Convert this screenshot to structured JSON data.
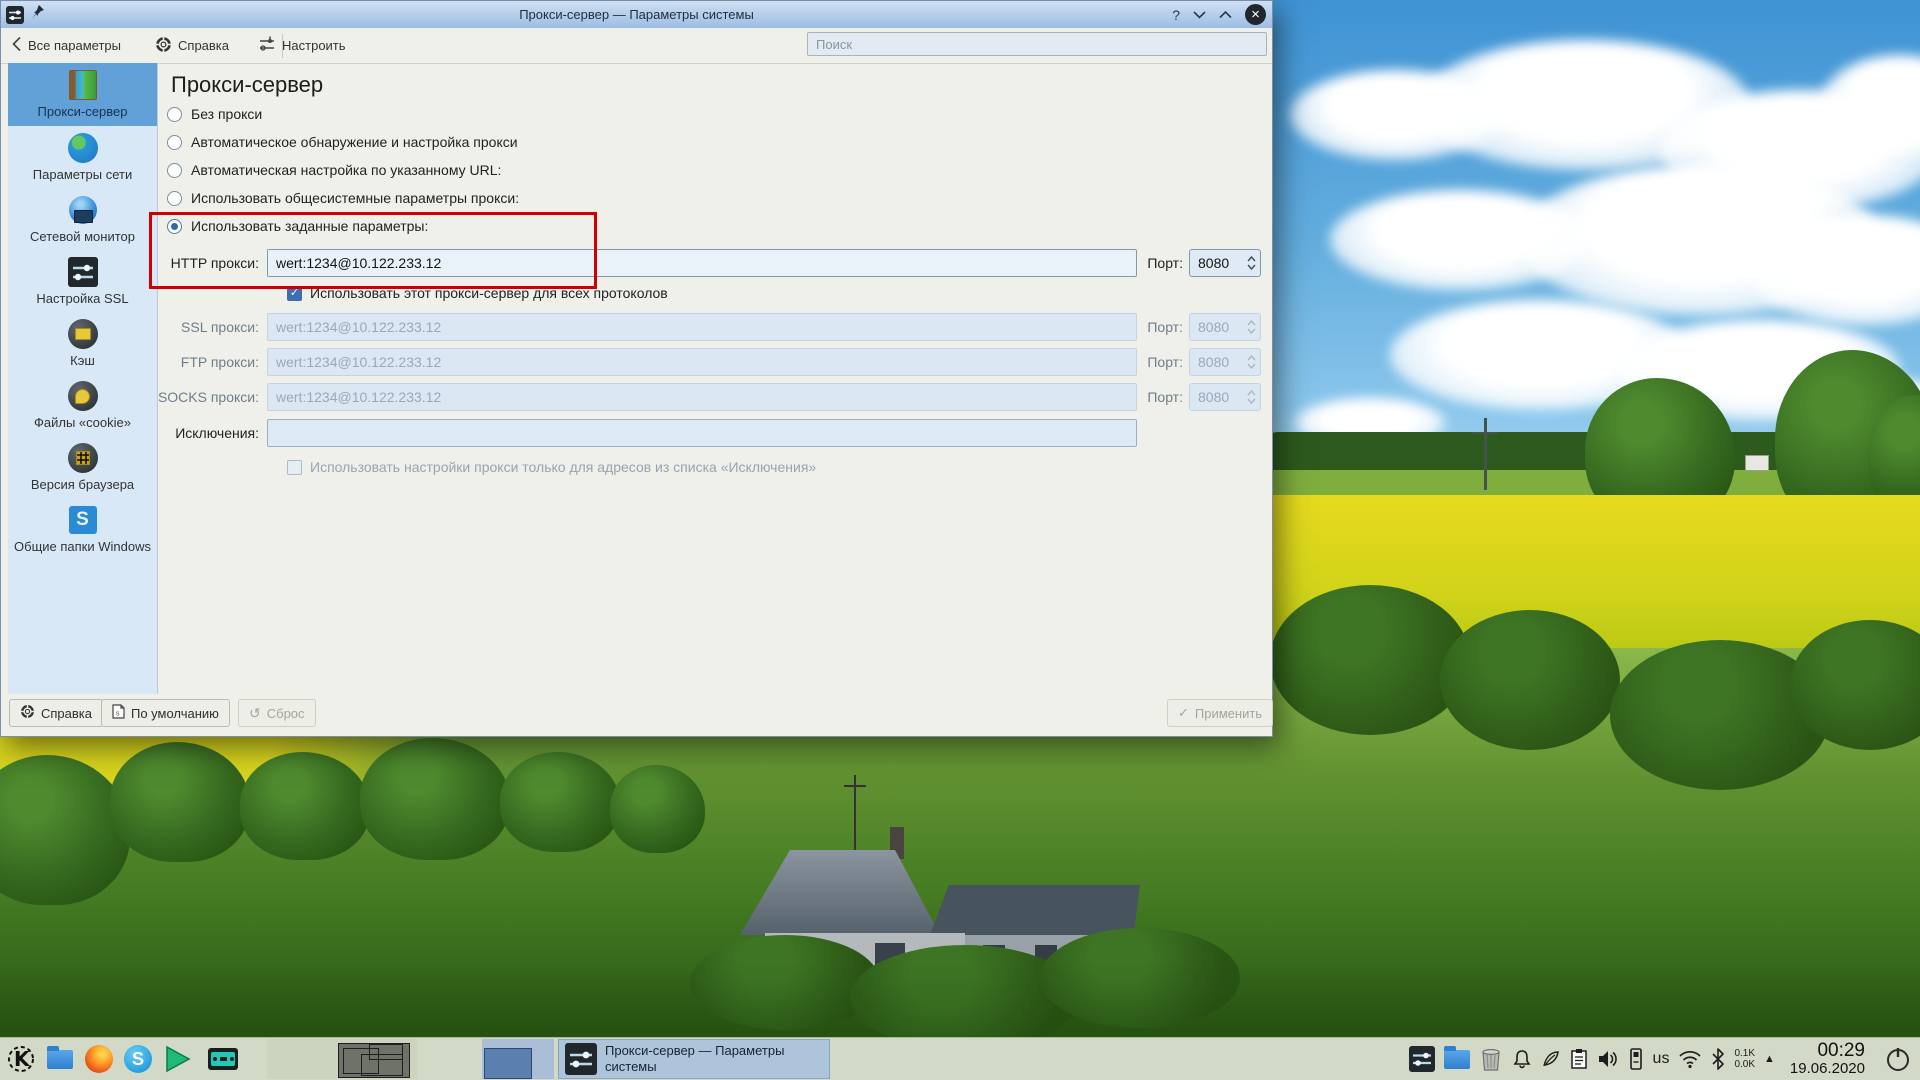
{
  "icons": {
    "check": "✓",
    "question": "?",
    "close": "×",
    "undo": "↺",
    "arrow_up_small": "▲"
  },
  "colors": {
    "accent_blue": "#3d6db2",
    "annotation_red": "#d10000",
    "sidebar_selected": "#62a0d8",
    "titlebar": "#9cbde2",
    "taskbar_bg": "#d2d9c6"
  },
  "titlebar": {
    "title": "Прокси-сервер — Параметры системы"
  },
  "toolbar": {
    "back_label": "Все параметры",
    "help_label": "Справка",
    "configure_label": "Настроить",
    "search_placeholder": "Поиск"
  },
  "sidebar": {
    "items": [
      {
        "label": "Прокси-сервер",
        "selected": true
      },
      {
        "label": "Параметры сети",
        "selected": false
      },
      {
        "label": "Сетевой монитор",
        "selected": false
      },
      {
        "label": "Настройка SSL",
        "selected": false
      },
      {
        "label": "Кэш",
        "selected": false
      },
      {
        "label": "Файлы «cookie»",
        "selected": false
      },
      {
        "label": "Версия браузера",
        "selected": false
      },
      {
        "label": "Общие папки Windows",
        "selected": false
      }
    ]
  },
  "content": {
    "title": "Прокси-сервер",
    "radio_options": [
      {
        "label": "Без прокси",
        "selected": false
      },
      {
        "label": "Автоматическое обнаружение и настройка прокси",
        "selected": false
      },
      {
        "label": "Автоматическая настройка по указанному URL:",
        "selected": false
      },
      {
        "label": "Использовать общесистемные параметры прокси:",
        "selected": false
      },
      {
        "label": "Использовать заданные параметры:",
        "selected": true
      }
    ],
    "port_label": "Порт:",
    "rows": {
      "http": {
        "label": "HTTP прокси:",
        "value": "wert:1234@10.122.233.12",
        "port": "8080",
        "enabled": true
      },
      "ssl": {
        "label": "SSL прокси:",
        "value": "wert:1234@10.122.233.12",
        "port": "8080",
        "enabled": false
      },
      "ftp": {
        "label": "FTP прокси:",
        "value": "wert:1234@10.122.233.12",
        "port": "8080",
        "enabled": false
      },
      "socks": {
        "label": "SOCKS прокси:",
        "value": "wert:1234@10.122.233.12",
        "port": "8080",
        "enabled": false
      },
      "exceptions": {
        "label": "Исключения:",
        "value": ""
      }
    },
    "checkbox_all_protocols": "Использовать этот прокси-сервер для всех протоколов",
    "checkbox_only_list": "Использовать настройки прокси только для адресов из списка «Исключения»"
  },
  "footer": {
    "help": "Справка",
    "defaults": "По умолчанию",
    "reset": "Сброс",
    "apply": "Применить"
  },
  "taskbar": {
    "task": {
      "line1": "Прокси-сервер  — Параметры",
      "line2": "системы"
    },
    "keyboard_layout": "us",
    "net_up": "0.1K",
    "net_down": "0.0K",
    "time": "00:29",
    "date": "19.06.2020"
  }
}
